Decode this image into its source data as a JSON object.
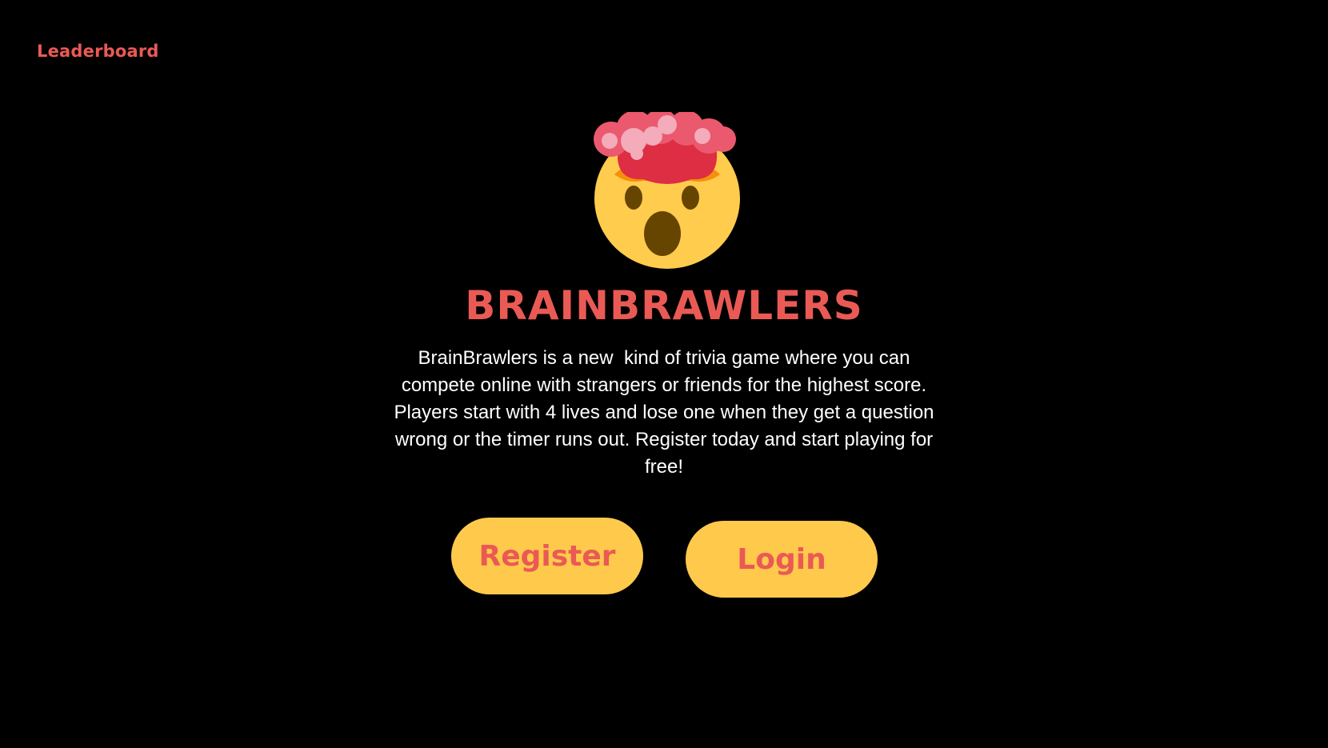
{
  "nav": {
    "leaderboard_label": "Leaderboard"
  },
  "hero": {
    "logo_icon": "exploding-head-emoji",
    "title": "BRAINBRAWLERS",
    "description": "BrainBrawlers is a new  kind of trivia game where you can compete online with strangers or friends for the highest score. Players start with 4 lives and lose one when they get a question wrong or the timer runs out. Register today and start playing for free!"
  },
  "actions": {
    "register_label": "Register",
    "login_label": "Login"
  },
  "colors": {
    "background": "#000000",
    "accent": "#ea5a55",
    "button_bg": "#ffc94c",
    "text": "#ffffff"
  }
}
